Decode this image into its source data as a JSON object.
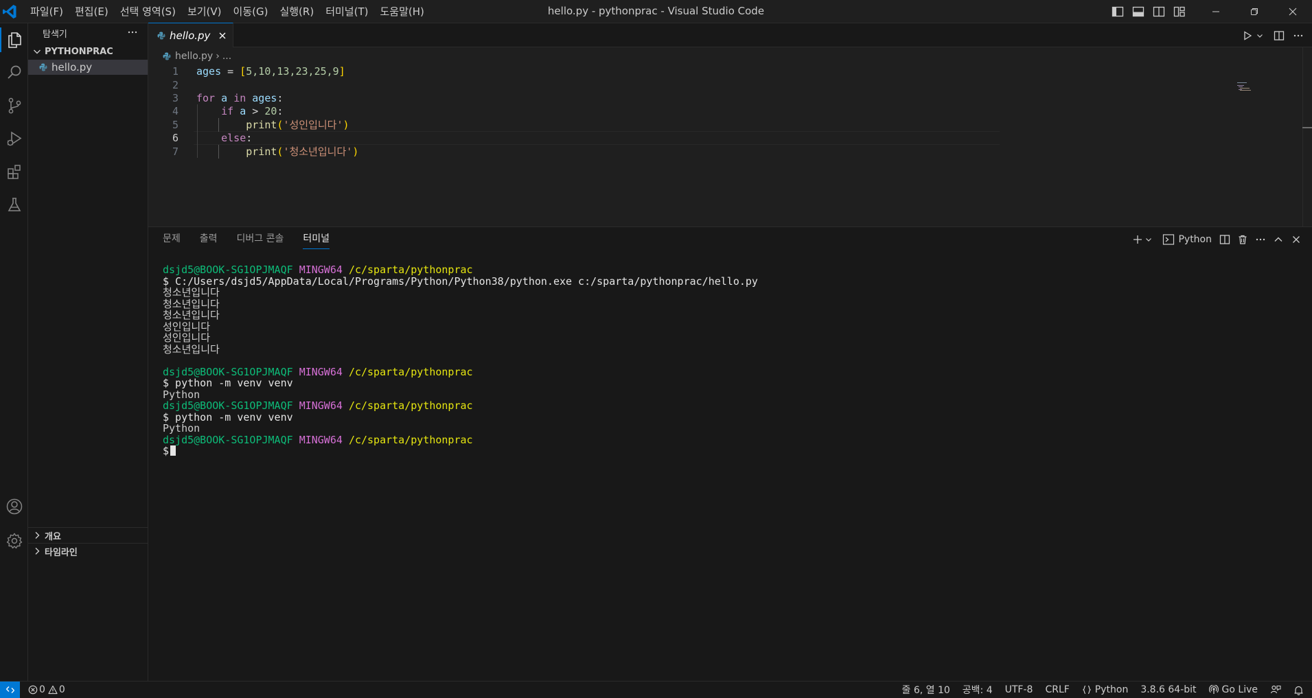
{
  "window": {
    "title": "hello.py - pythonprac - Visual Studio Code"
  },
  "menu": [
    "파일(F)",
    "편집(E)",
    "선택 영역(S)",
    "보기(V)",
    "이동(G)",
    "실행(R)",
    "터미널(T)",
    "도움말(H)"
  ],
  "sidebar": {
    "title": "탐색기",
    "folder": "PYTHONPRAC",
    "files": [
      "hello.py"
    ],
    "outline": "개요",
    "timeline": "타임라인"
  },
  "editor": {
    "tab": "hello.py",
    "breadcrumb": {
      "file": "hello.py",
      "more": "..."
    },
    "current_line": 6,
    "line_numbers": [
      "1",
      "2",
      "3",
      "4",
      "5",
      "6",
      "7"
    ],
    "code": {
      "l1": {
        "var": "ages",
        "op": " = ",
        "open": "[",
        "nums": "5,10,13,23,25,9",
        "close": "]"
      },
      "l3": {
        "for": "for",
        "a": "a",
        "in": "in",
        "ages": "ages",
        "colon": ":"
      },
      "l4": {
        "if": "if",
        "a": "a",
        "op": " > ",
        "num": "20",
        "colon": ":"
      },
      "l5": {
        "fn": "print",
        "open": "(",
        "str": "'성인입니다'",
        "close": ")"
      },
      "l6": {
        "else": "else",
        "colon": ":"
      },
      "l7": {
        "fn": "print",
        "open": "(",
        "str": "'청소년입니다'",
        "close": ")"
      }
    }
  },
  "panel": {
    "tabs": [
      "문제",
      "출력",
      "디버그 콘솔",
      "터미널"
    ],
    "active_tab": "터미널",
    "terminal_profile": "Python",
    "prompt": {
      "user": "dsjd5@BOOK-SG1OPJMAQF",
      "shell": "MINGW64",
      "path": "/c/sparta/pythonprac"
    },
    "terminal_lines": {
      "cmd1": "$ C:/Users/dsjd5/AppData/Local/Programs/Python/Python38/python.exe c:/sparta/pythonprac/hello.py",
      "out1": "청소년입니다",
      "out2": "청소년입니다",
      "out3": "청소년입니다",
      "out4": "성인입니다",
      "out5": "성인입니다",
      "out6": "청소년입니다",
      "cmd2": "$ python -m venv venv",
      "out7": "Python",
      "cmd3": "$ python -m venv venv",
      "out8": "Python",
      "prompt_end": "$"
    }
  },
  "statusbar": {
    "errors": "0",
    "warnings": "0",
    "position": "줄 6, 열 10",
    "spaces": "공백: 4",
    "encoding": "UTF-8",
    "eol": "CRLF",
    "language": "Python",
    "interpreter": "3.8.6 64-bit",
    "golive": "Go Live"
  },
  "colors": {
    "accent": "#0078d4",
    "background": "#1f1f1f",
    "sidebar": "#181818"
  }
}
